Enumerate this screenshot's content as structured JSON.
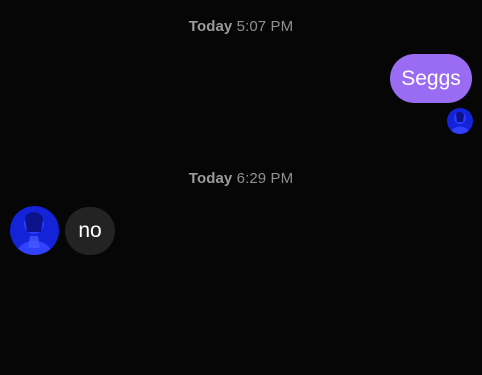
{
  "messages": [
    {
      "timestamp": {
        "day": "Today",
        "time": "5:07 PM"
      },
      "direction": "outgoing",
      "text": "Seggs",
      "bubble_color": "#9a6cf4",
      "avatar": "profile-photo-icon"
    },
    {
      "timestamp": {
        "day": "Today",
        "time": "6:29 PM"
      },
      "direction": "incoming",
      "text": "no",
      "bubble_color": "#232323",
      "avatar": "profile-photo-icon"
    }
  ],
  "colors": {
    "background": "#060606",
    "timestamp_text": "#8f8f8f",
    "avatar_tint": "#1a2cff"
  }
}
